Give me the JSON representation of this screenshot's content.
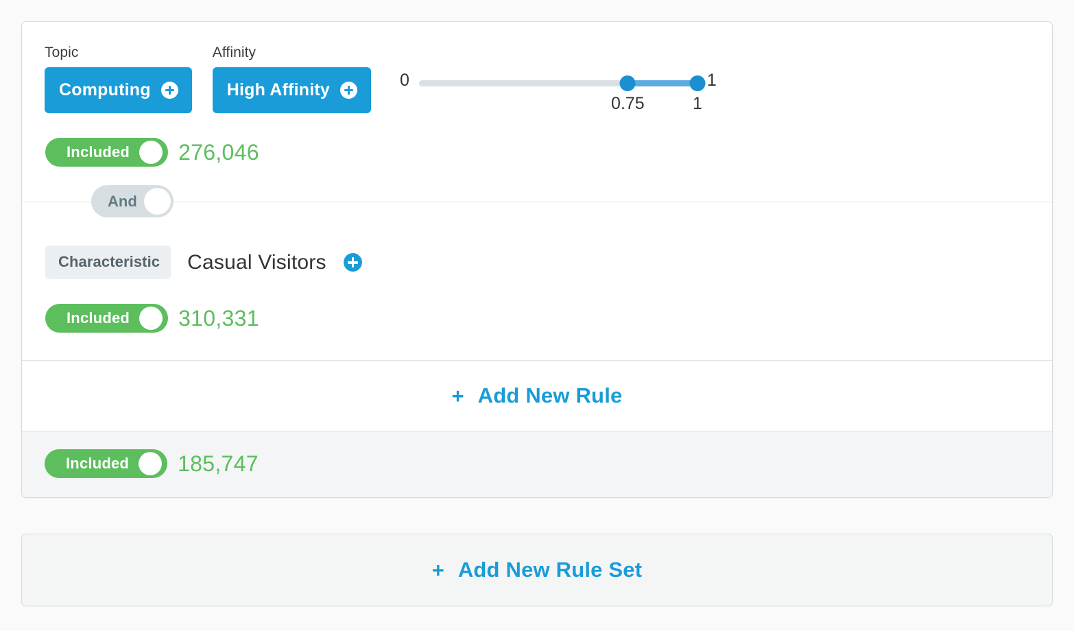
{
  "ruleset": {
    "rule1": {
      "topic": {
        "label": "Topic",
        "value": "Computing",
        "add_icon": "plus-circle-icon"
      },
      "affinity": {
        "label": "Affinity",
        "value": "High Affinity",
        "add_icon": "plus-circle-icon"
      },
      "slider": {
        "min_label": "0",
        "max_label": "1",
        "lower_value": "0.75",
        "upper_value": "1",
        "min": 0,
        "max": 1,
        "lower": 0.75,
        "upper": 1,
        "track_color": "#d9dfe2",
        "range_color": "#5aadde",
        "handle_color": "#1b8fd0"
      },
      "included": {
        "label": "Included",
        "count": "276,046",
        "state": "on",
        "color": "#5cbe5c"
      }
    },
    "operator": {
      "label": "And",
      "state": "on",
      "color": "#d7dee1"
    },
    "rule2": {
      "badge": "Characteristic",
      "value": "Casual Visitors",
      "add_icon": "plus-circle-icon",
      "included": {
        "label": "Included",
        "count": "310,331",
        "state": "on",
        "color": "#5cbe5c"
      }
    },
    "add_rule": {
      "plus": "+",
      "label": "Add New Rule",
      "color": "#1a9cd8"
    },
    "footer": {
      "included": {
        "label": "Included",
        "count": "185,747",
        "state": "on",
        "color": "#5cbe5c"
      }
    }
  },
  "add_ruleset": {
    "plus": "+",
    "label": "Add New Rule Set",
    "color": "#1a9cd8"
  }
}
